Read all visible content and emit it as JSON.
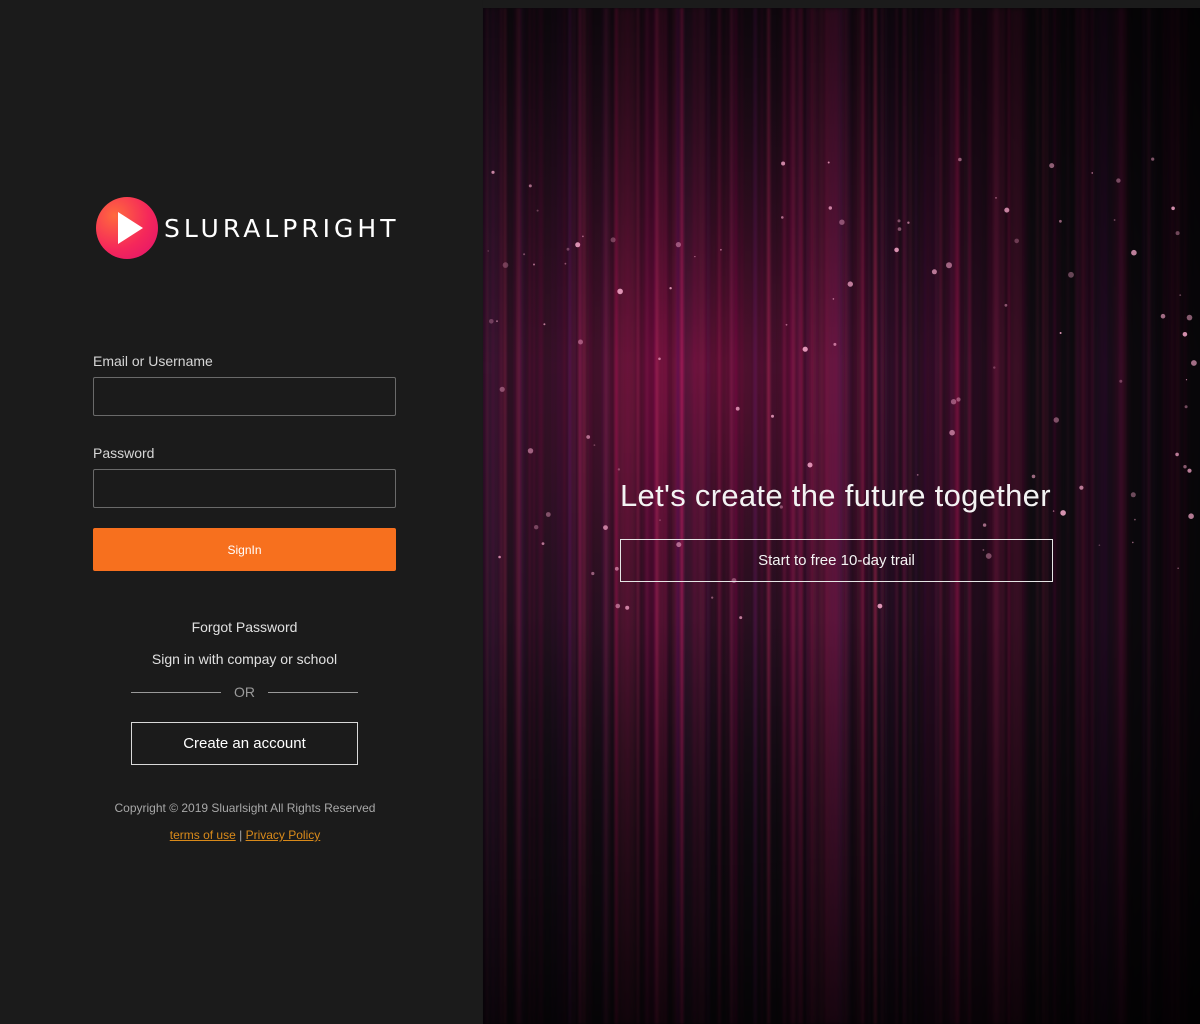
{
  "brand": {
    "name": "SLURALPRIGHT",
    "colors": {
      "accent": "#f7701e",
      "logo_gradient_start": "#ff6a3d",
      "logo_gradient_end": "#e0106e",
      "link": "#d98a1a"
    },
    "logo_icon": "play-icon"
  },
  "login_form": {
    "email_label": "Email or Username",
    "email_value": "",
    "password_label": "Password",
    "password_value": "",
    "signin_label": "SignIn"
  },
  "links": {
    "forgot_password": "Forgot Password",
    "sign_in_company": "Sign in with compay or school",
    "or_text": "OR",
    "create_account": "Create an account"
  },
  "footer": {
    "copyright": "Copyright © 2019 Sluarlsight All Rights Reserved",
    "terms": "terms of use",
    "separator": "|",
    "privacy": "Privacy Policy"
  },
  "hero": {
    "tagline": "Let's create the future together",
    "trial_button": "Start to free 10-day trail"
  }
}
